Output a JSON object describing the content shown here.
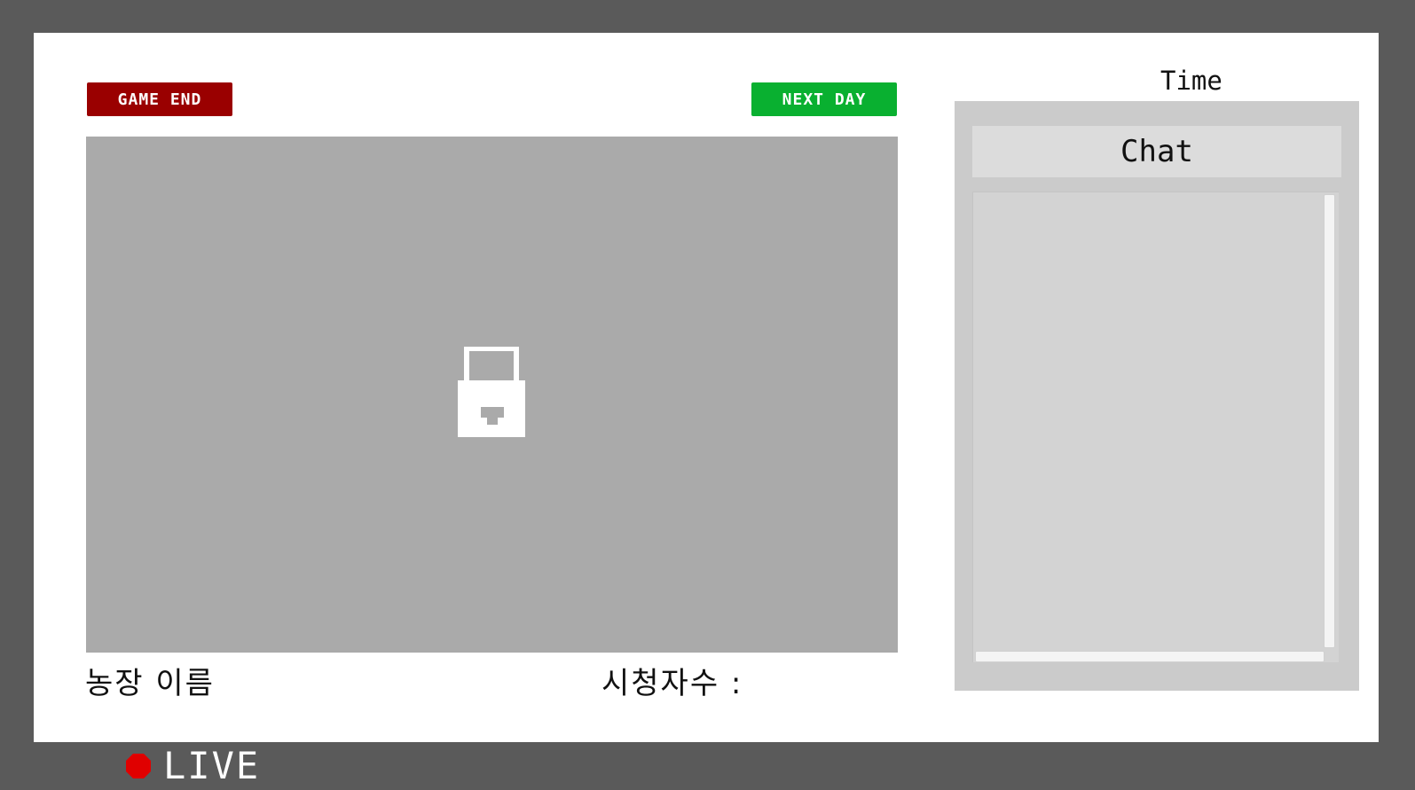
{
  "buttons": {
    "game_end": "GAME END",
    "next_day": "NEXT DAY"
  },
  "stage": {
    "icon": "lock-icon"
  },
  "info": {
    "farm_name": "농장 이름",
    "viewers_label": "시청자수 :"
  },
  "chat": {
    "time_label": "Time",
    "title": "Chat"
  },
  "live": {
    "label": "LIVE",
    "icon": "record-dot-icon"
  },
  "colors": {
    "background": "#5a5a5a",
    "frame": "#ffffff",
    "game_end": "#9a0000",
    "next_day": "#09b030",
    "stage": "#aaaaaa",
    "chat_panel": "#cbcbcb",
    "live_dot": "#e00000"
  }
}
